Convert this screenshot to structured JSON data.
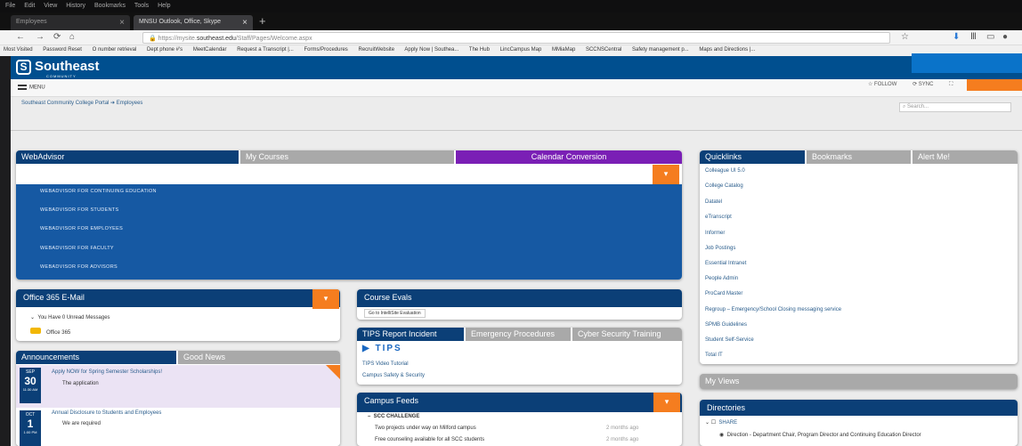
{
  "browser": {
    "menu": [
      "File",
      "Edit",
      "View",
      "History",
      "Bookmarks",
      "Tools",
      "Help"
    ],
    "tabs": [
      {
        "label": "Employees"
      },
      {
        "label": "MNSU Outlook, Office, Skype"
      }
    ],
    "url_prefix": "https://mysite.",
    "url_domain": "southeast.edu",
    "url_rest": "/Staff/Pages/Welcome.aspx",
    "bookmarks": [
      "Most Visited",
      "Password Reset",
      "O number retrieval",
      "Dept phone #'s",
      "MeetCalendar",
      "Request a Transcript |...",
      "Forms/Procedures",
      "RecruitWebsite",
      "Apply Now | Southea...",
      "The Hub",
      "LincCampus Map",
      "MMiaMap",
      "SCCNSCentral",
      "Safety management p...",
      "Maps and Directions |..."
    ]
  },
  "site": {
    "logo_text": "Southeast",
    "logo_sub": "COMMUNITY COLLEGE",
    "menu_label": "MENU",
    "follow": [
      "FOLLOW",
      "SYNC"
    ],
    "breadcrumb": "Southeast Community College Portal ➔ Employees",
    "search_placeholder": "Search..."
  },
  "webadvisor": {
    "tabs": [
      "WebAdvisor",
      "My Courses",
      "Calendar Conversion"
    ],
    "items": [
      "WEBADVISOR FOR CONTINUING EDUCATION",
      "WEBADVISOR FOR STUDENTS",
      "WEBADVISOR FOR EMPLOYEES",
      "WEBADVISOR FOR FACULTY",
      "WEBADVISOR FOR ADVISORS"
    ]
  },
  "office365": {
    "title": "Office 365 E-Mail",
    "unread": "You Have 0 Unread Messages",
    "link": "Office 365"
  },
  "announcements": {
    "tabs": [
      "Announcements",
      "Good News"
    ],
    "items": [
      {
        "month": "SEP",
        "day": "30",
        "time": "11:30 AM",
        "title": "Apply NOW for Spring Semester Scholarships!",
        "body": "The application"
      },
      {
        "month": "OCT",
        "day": "1",
        "time": "1:00 PM",
        "title": "Annual Disclosure to Students and Employees",
        "body": "We are required"
      }
    ]
  },
  "course_evals": {
    "title": "Course Evals",
    "link": "Go to IntelliSite Evaluation"
  },
  "tips": {
    "tabs": [
      "TIPS Report Incident",
      "Emergency Procedures",
      "Cyber Security Training"
    ],
    "logo": "TIPS",
    "links": [
      "TIPS Video Tutorial",
      "Campus Safety & Security"
    ]
  },
  "campus_feeds": {
    "title": "Campus Feeds",
    "group": "SCC CHALLENGE",
    "items": [
      {
        "text": "Two projects under way on Milford campus",
        "age": "2 months ago"
      },
      {
        "text": "Free counseling available for all SCC students",
        "age": "2 months ago"
      }
    ]
  },
  "quicklinks": {
    "tabs": [
      "Quicklinks",
      "Bookmarks",
      "Alert Me!"
    ],
    "items": [
      "Colleague UI 5.0",
      "College Catalog",
      "Datatel",
      "eTranscript",
      "Informer",
      "Job Postings",
      "Essential Intranet",
      "People Admin",
      "ProCard Master",
      "Regroup – Emergency/School Closing messaging service",
      "SPMB Guidelines",
      "Student Self-Service",
      "Total IT"
    ]
  },
  "my_views": {
    "title": "My Views"
  },
  "directories": {
    "title": "Directories",
    "group": "SHARE",
    "item": "Direction - Department Chair, Program Director and Continuing Education Director"
  }
}
